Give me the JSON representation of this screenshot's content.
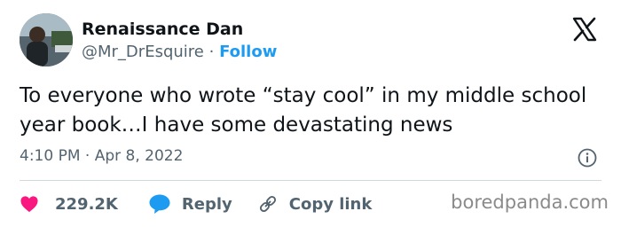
{
  "author": {
    "display_name": "Renaissance Dan",
    "handle": "@Mr_DrEsquire",
    "separator": "·",
    "follow_label": "Follow",
    "avatar_icon": "profile-photo"
  },
  "platform_icon": "x-logo-icon",
  "tweet": {
    "text": "To everyone who wrote “stay cool” in my middle school year book…I have some devastating news",
    "timestamp": "4:10 PM · Apr 8, 2022"
  },
  "actions": {
    "likes_count": "229.2K",
    "reply_label": "Reply",
    "copy_link_label": "Copy link"
  },
  "colors": {
    "accent": "#1d9bf0",
    "like": "#f91880",
    "secondary_text": "#536471"
  },
  "watermark": "boredpanda.com"
}
